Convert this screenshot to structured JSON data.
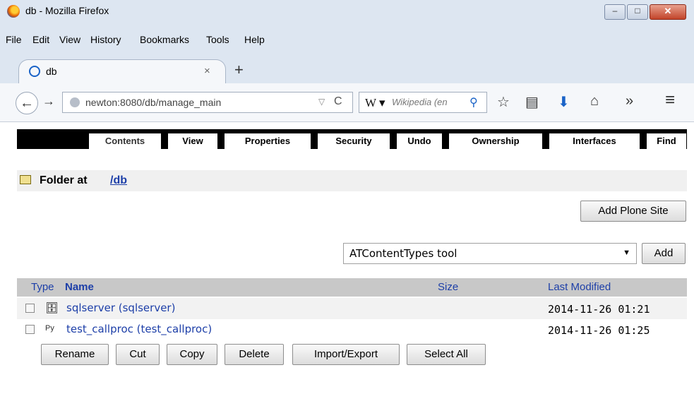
{
  "window": {
    "title": "db - Mozilla Firefox",
    "minimize": "–",
    "maximize": "□",
    "close": "✕"
  },
  "menu": {
    "items": [
      "File",
      "Edit",
      "View",
      "History",
      "Bookmarks",
      "Tools",
      "Help"
    ]
  },
  "browser_tab": {
    "title": "db",
    "close": "×",
    "new_tab": "+"
  },
  "nav": {
    "back": "←",
    "forward": "→",
    "url": "newton:8080/db/manage_main",
    "url_dropdown": "▽",
    "reload": "C",
    "search_engine": "W ▾",
    "search_placeholder": "Wikipedia (en",
    "search_go": "⚲",
    "bookmark": "☆",
    "reading_list": "▤",
    "download": "⬇",
    "home": "⌂",
    "overflow": "»",
    "menu": "≡"
  },
  "zmi": {
    "tabs": [
      "Contents",
      "View",
      "Properties",
      "Security",
      "Undo",
      "Ownership",
      "Interfaces",
      "Find"
    ],
    "folder_label": "Folder at",
    "folder_path": "/db",
    "add_plone_site": "Add Plone Site",
    "add_select_value": "ATContentTypes tool",
    "add_button": "Add",
    "columns": {
      "type": "Type",
      "name": "Name",
      "size": "Size",
      "modified": "Last Modified"
    },
    "rows": [
      {
        "icon": "sql-connection-icon",
        "name": "sqlserver (sqlserver)",
        "size": "",
        "modified": "2014-11-26 01:21"
      },
      {
        "icon": "python-script-icon",
        "name": "test_callproc (test_callproc)",
        "size": "",
        "modified": "2014-11-26 01:25"
      }
    ],
    "actions": [
      "Rename",
      "Cut",
      "Copy",
      "Delete",
      "Import/Export",
      "Select All"
    ]
  }
}
